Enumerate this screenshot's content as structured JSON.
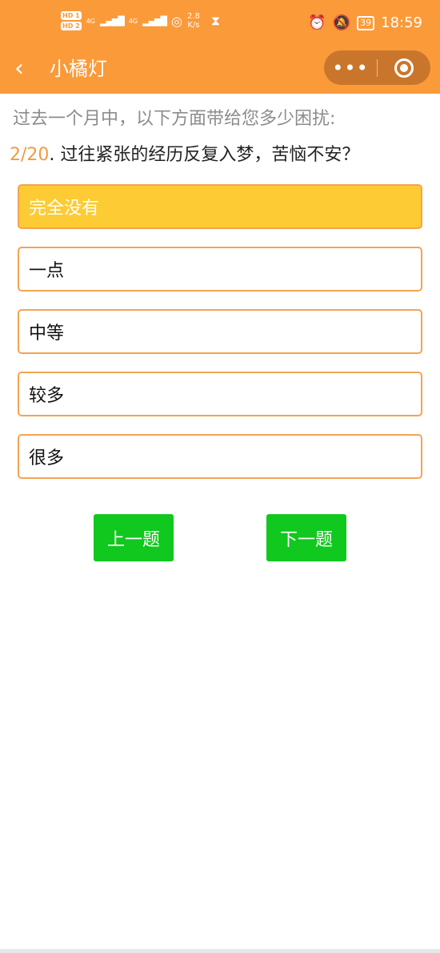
{
  "status_bar": {
    "hd1": "HD 1",
    "hd2": "HD 2",
    "net1": "4G",
    "net2": "4G",
    "speed_value": "2.8",
    "speed_unit": "K/s",
    "battery": "39",
    "time": "18:59",
    "icons": [
      "signal-icon",
      "wifi-icon",
      "hourglass-icon",
      "alarm-icon",
      "mute-icon",
      "battery-icon"
    ]
  },
  "nav": {
    "back_glyph": "‹",
    "title": "小橘灯",
    "more_glyph": "•••"
  },
  "survey": {
    "intro": "过去一个月中，以下方面带给您多少困扰:",
    "question_number": "2/20",
    "question_text": ". 过往紧张的经历反复入梦，苦恼不安？",
    "options": [
      {
        "label": "完全没有",
        "selected": true
      },
      {
        "label": "一点",
        "selected": false
      },
      {
        "label": "中等",
        "selected": false
      },
      {
        "label": "较多",
        "selected": false
      },
      {
        "label": "很多",
        "selected": false
      }
    ],
    "prev_label": "上一题",
    "next_label": "下一题"
  },
  "colors": {
    "header": "#fb9a39",
    "option_border": "#f2a453",
    "selected_fill": "#fdcb33",
    "button": "#11c81e",
    "question_number": "#f39b3e"
  }
}
